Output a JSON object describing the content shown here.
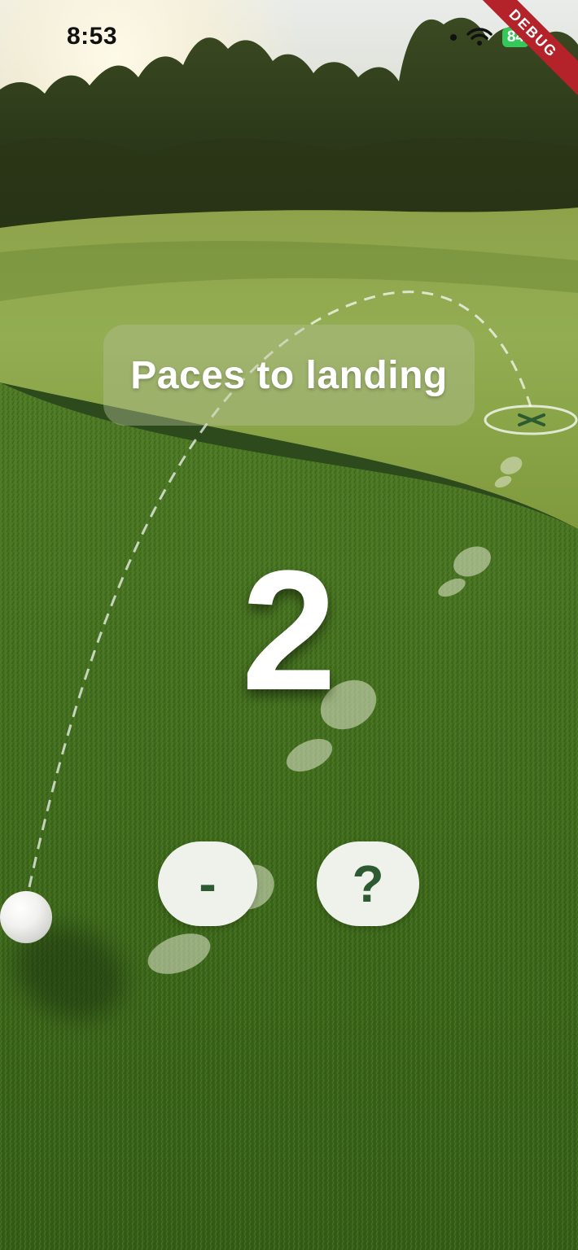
{
  "status_bar": {
    "time": "8:53",
    "battery": "84"
  },
  "debug_banner": "DEBUG",
  "instruction": {
    "label": "Paces to landing"
  },
  "pace_counter": {
    "value": "2"
  },
  "controls": {
    "decrement_label": "-",
    "help_label": "?"
  },
  "icons": [
    "wifi-icon",
    "battery-icon",
    "target-icon",
    "footprint-icon",
    "golf-ball-icon"
  ],
  "colors": {
    "button_bg": "#eff2ea",
    "button_text": "#2e5a32",
    "debug_banner": "#b4232a",
    "battery": "#34c759"
  }
}
